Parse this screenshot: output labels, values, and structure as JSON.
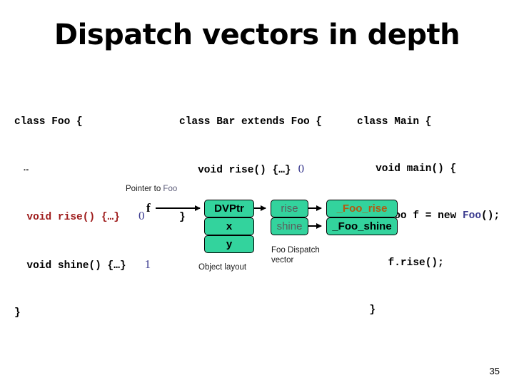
{
  "slide": {
    "title": "Dispatch vectors in depth",
    "page_number": "35"
  },
  "code": {
    "foo": {
      "l1": "class Foo {",
      "l2": "  …",
      "l3_sig": "  void rise() {…}",
      "l3_idx": "0",
      "l4_sig": "  void shine() {…}",
      "l4_idx": "1",
      "l5": "}"
    },
    "bar": {
      "l1": "class Bar extends Foo {",
      "l2_sig": "   void rise() {…}",
      "l2_idx": "0",
      "l3": "}"
    },
    "main": {
      "l1": "class Main {",
      "l2": "   void main() {",
      "l3_a": "     Foo f = new ",
      "l3_b": "Foo",
      "l3_c": "();",
      "l4": "     f.rise();",
      "l5": "  }"
    }
  },
  "diagram": {
    "pointer_label_prefix": "Pointer to ",
    "pointer_label_type": "Foo",
    "var_name": "f",
    "object_layout_label": "Object layout",
    "dispatch_vector_label": "Foo Dispatch\nvector",
    "object_fields": [
      "DVPtr",
      "x",
      "y"
    ],
    "dispatch_entries": [
      "rise",
      "shine"
    ],
    "function_bodies": [
      "_Foo_rise",
      "_Foo_shine"
    ]
  },
  "colors": {
    "box_fill": "#33d39d",
    "box_border": "#000000",
    "code_red": "#9e1b1b",
    "code_blue": "#3b3b8f",
    "fn_orange": "#b35a10",
    "entry_grey": "#5c5c5c"
  }
}
